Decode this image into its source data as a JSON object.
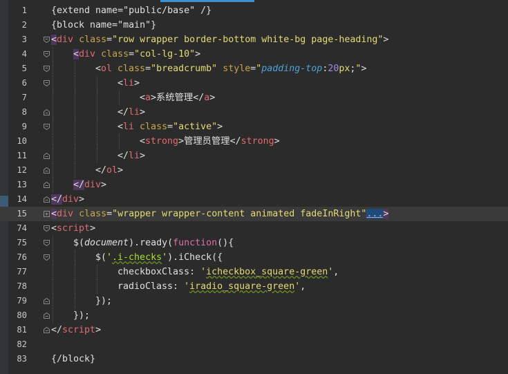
{
  "editor": {
    "lines": [
      {
        "num": "1",
        "indent": 0,
        "fold": "none",
        "tokens": [
          [
            "t-dim",
            "{extend name=\"public/base\" /}"
          ]
        ]
      },
      {
        "num": "2",
        "indent": 0,
        "fold": "none",
        "tokens": [
          [
            "t-dim",
            "{block name=\"main\"}"
          ]
        ]
      },
      {
        "num": "3",
        "indent": 0,
        "fold": "open",
        "tokens": [
          [
            "t-br hl",
            "<"
          ],
          [
            "t-tag",
            "div"
          ],
          [
            "t-dim",
            " "
          ],
          [
            "t-attr",
            "class"
          ],
          [
            "t-dim",
            "="
          ],
          [
            "t-str",
            "\"row wrapper border-bottom white-bg page-heading\""
          ],
          [
            "t-br",
            ">"
          ]
        ]
      },
      {
        "num": "4",
        "indent": 1,
        "fold": "open",
        "tokens": [
          [
            "t-br hl",
            "<"
          ],
          [
            "t-tag",
            "div"
          ],
          [
            "t-dim",
            " "
          ],
          [
            "t-attr",
            "class"
          ],
          [
            "t-dim",
            "="
          ],
          [
            "t-str",
            "\"col-lg-10\""
          ],
          [
            "t-br",
            ">"
          ]
        ]
      },
      {
        "num": "5",
        "indent": 2,
        "fold": "open",
        "tokens": [
          [
            "t-br",
            "<"
          ],
          [
            "t-tag",
            "ol"
          ],
          [
            "t-dim",
            " "
          ],
          [
            "t-attr",
            "class"
          ],
          [
            "t-dim",
            "="
          ],
          [
            "t-str",
            "\"breadcrumb\""
          ],
          [
            "t-dim",
            " "
          ],
          [
            "t-attr",
            "style"
          ],
          [
            "t-dim",
            "="
          ],
          [
            "t-str",
            "\""
          ],
          [
            "t-style",
            "padding-top"
          ],
          [
            "t-dim",
            ":"
          ],
          [
            "t-num",
            "20"
          ],
          [
            "t-str",
            "px"
          ],
          [
            "t-dim",
            ";"
          ],
          [
            "t-str",
            "\""
          ],
          [
            "t-br",
            ">"
          ]
        ]
      },
      {
        "num": "6",
        "indent": 3,
        "fold": "open",
        "tokens": [
          [
            "t-br",
            "<"
          ],
          [
            "t-tag",
            "li"
          ],
          [
            "t-br",
            ">"
          ]
        ]
      },
      {
        "num": "7",
        "indent": 4,
        "fold": "none",
        "tokens": [
          [
            "t-br",
            "<"
          ],
          [
            "t-tag",
            "a"
          ],
          [
            "t-br",
            ">"
          ],
          [
            "t-dim",
            "系统管理"
          ],
          [
            "t-br",
            "</"
          ],
          [
            "t-tag",
            "a"
          ],
          [
            "t-br",
            ">"
          ]
        ]
      },
      {
        "num": "8",
        "indent": 3,
        "fold": "close",
        "tokens": [
          [
            "t-br",
            "</"
          ],
          [
            "t-tag",
            "li"
          ],
          [
            "t-br",
            ">"
          ]
        ]
      },
      {
        "num": "9",
        "indent": 3,
        "fold": "open",
        "tokens": [
          [
            "t-br",
            "<"
          ],
          [
            "t-tag",
            "li"
          ],
          [
            "t-dim",
            " "
          ],
          [
            "t-attr",
            "class"
          ],
          [
            "t-dim",
            "="
          ],
          [
            "t-str",
            "\"active\""
          ],
          [
            "t-br",
            ">"
          ]
        ]
      },
      {
        "num": "10",
        "indent": 4,
        "fold": "none",
        "tokens": [
          [
            "t-br",
            "<"
          ],
          [
            "t-tag",
            "strong"
          ],
          [
            "t-br",
            ">"
          ],
          [
            "t-dim",
            "管理员管理"
          ],
          [
            "t-br",
            "</"
          ],
          [
            "t-tag",
            "strong"
          ],
          [
            "t-br",
            ">"
          ]
        ]
      },
      {
        "num": "11",
        "indent": 3,
        "fold": "close",
        "tokens": [
          [
            "t-br",
            "</"
          ],
          [
            "t-tag",
            "li"
          ],
          [
            "t-br",
            ">"
          ]
        ]
      },
      {
        "num": "12",
        "indent": 2,
        "fold": "close",
        "tokens": [
          [
            "t-br",
            "</"
          ],
          [
            "t-tag",
            "ol"
          ],
          [
            "t-br",
            ">"
          ]
        ]
      },
      {
        "num": "13",
        "indent": 1,
        "fold": "close",
        "tokens": [
          [
            "t-br hl",
            "</"
          ],
          [
            "t-tag",
            "div"
          ],
          [
            "t-br",
            ">"
          ]
        ]
      },
      {
        "num": "14",
        "indent": 0,
        "fold": "close",
        "tokens": [
          [
            "t-br hl",
            "</"
          ],
          [
            "t-tag",
            "div"
          ],
          [
            "t-br",
            ">"
          ]
        ]
      },
      {
        "num": "15",
        "indent": 0,
        "fold": "collapsed",
        "active": true,
        "tokens": [
          [
            "t-br hl",
            "<"
          ],
          [
            "t-tag",
            "div"
          ],
          [
            "t-dim",
            " "
          ],
          [
            "t-attr",
            "class"
          ],
          [
            "t-dim",
            "="
          ],
          [
            "t-str",
            "\"wrapper wrapper-content animated fadeInRight\""
          ],
          [
            "t-ell",
            "..."
          ],
          [
            "t-br hl",
            ">"
          ]
        ]
      },
      {
        "num": "74",
        "indent": 0,
        "fold": "open",
        "tokens": [
          [
            "t-br",
            "<"
          ],
          [
            "t-tag",
            "script"
          ],
          [
            "t-br",
            ">"
          ]
        ]
      },
      {
        "num": "75",
        "indent": 1,
        "fold": "open",
        "tokens": [
          [
            "t-dim",
            "$("
          ],
          [
            "t-it",
            "document"
          ],
          [
            "t-dim",
            ").ready("
          ],
          [
            "t-kw",
            "function"
          ],
          [
            "t-dim",
            "(){"
          ]
        ]
      },
      {
        "num": "76",
        "indent": 2,
        "fold": "open",
        "tokens": [
          [
            "t-dim",
            "$("
          ],
          [
            "t-str",
            "'"
          ],
          [
            "t-cls sq",
            ".i-checks"
          ],
          [
            "t-str",
            "'"
          ],
          [
            "t-dim",
            ").iCheck({"
          ]
        ]
      },
      {
        "num": "77",
        "indent": 3,
        "fold": "none",
        "tokens": [
          [
            "t-dim",
            "checkboxClass: "
          ],
          [
            "t-str",
            "'"
          ],
          [
            "t-str sq",
            "icheckbox_square-green"
          ],
          [
            "t-str",
            "'"
          ],
          [
            "t-dim",
            ","
          ]
        ]
      },
      {
        "num": "78",
        "indent": 3,
        "fold": "none",
        "tokens": [
          [
            "t-dim",
            "radioClass: "
          ],
          [
            "t-str",
            "'"
          ],
          [
            "t-str sq",
            "iradio_square-green"
          ],
          [
            "t-str",
            "'"
          ],
          [
            "t-dim",
            ","
          ]
        ]
      },
      {
        "num": "79",
        "indent": 2,
        "fold": "close",
        "tokens": [
          [
            "t-dim",
            "});"
          ]
        ]
      },
      {
        "num": "80",
        "indent": 1,
        "fold": "close",
        "tokens": [
          [
            "t-dim",
            "});"
          ]
        ]
      },
      {
        "num": "81",
        "indent": 0,
        "fold": "close",
        "tokens": [
          [
            "t-br",
            "</"
          ],
          [
            "t-tag",
            "script"
          ],
          [
            "t-br",
            ">"
          ]
        ]
      },
      {
        "num": "82",
        "indent": 0,
        "fold": "none",
        "tokens": []
      },
      {
        "num": "83",
        "indent": 0,
        "fold": "none",
        "tokens": [
          [
            "t-dim",
            "{/block}"
          ]
        ]
      }
    ]
  },
  "colors": {
    "background": "#2b2b2b",
    "gutter": "#313335",
    "active_line": "#3a3a3a",
    "tag": "#e36a72",
    "attribute": "#c9a44a",
    "string": "#e6db74",
    "keyword": "#df6ea2",
    "accent": "#3d8fd0"
  }
}
